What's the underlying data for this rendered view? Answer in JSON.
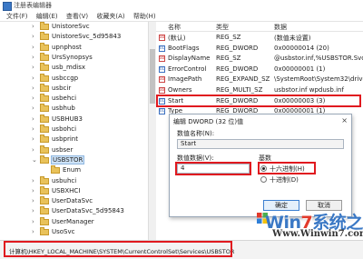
{
  "window": {
    "title": "注册表编辑器"
  },
  "menu": [
    "文件(F)",
    "编辑(E)",
    "查看(V)",
    "收藏夹(A)",
    "帮助(H)"
  ],
  "tree": {
    "items": [
      {
        "label": "UnistoreSvc",
        "level": 0,
        "expander": "›"
      },
      {
        "label": "UnistoreSvc_5d95843",
        "level": 0,
        "expander": "›"
      },
      {
        "label": "upnphost",
        "level": 0,
        "expander": "›"
      },
      {
        "label": "UrsSynopsys",
        "level": 0,
        "expander": "›"
      },
      {
        "label": "usb_mdisx",
        "level": 0,
        "expander": "›"
      },
      {
        "label": "usbccgp",
        "level": 0,
        "expander": "›"
      },
      {
        "label": "usbcir",
        "level": 0,
        "expander": "›"
      },
      {
        "label": "usbehci",
        "level": 0,
        "expander": "›"
      },
      {
        "label": "usbhub",
        "level": 0,
        "expander": "›"
      },
      {
        "label": "USBHUB3",
        "level": 0,
        "expander": "›"
      },
      {
        "label": "usbohci",
        "level": 0,
        "expander": "›"
      },
      {
        "label": "usbprint",
        "level": 0,
        "expander": "›"
      },
      {
        "label": "usbser",
        "level": 0,
        "expander": "›"
      },
      {
        "label": "USBSTOR",
        "level": 0,
        "expander": "⌄",
        "selected": true
      },
      {
        "label": "Enum",
        "level": 1,
        "expander": ""
      },
      {
        "label": "usbuhci",
        "level": 0,
        "expander": "›"
      },
      {
        "label": "USBXHCI",
        "level": 0,
        "expander": "›"
      },
      {
        "label": "UserDataSvc",
        "level": 0,
        "expander": "›"
      },
      {
        "label": "UserDataSvc_5d95843",
        "level": 0,
        "expander": "›"
      },
      {
        "label": "UserManager",
        "level": 0,
        "expander": "›"
      },
      {
        "label": "UsoSvc",
        "level": 0,
        "expander": "›"
      }
    ]
  },
  "values": {
    "headers": {
      "name": "名称",
      "type": "类型",
      "data": "数据"
    },
    "rows": [
      {
        "icon": "sz",
        "name": "(默认)",
        "type": "REG_SZ",
        "data": "(数值未设置)"
      },
      {
        "icon": "dw",
        "name": "BootFlags",
        "type": "REG_DWORD",
        "data": "0x00000014 (20)"
      },
      {
        "icon": "sz",
        "name": "DisplayName",
        "type": "REG_SZ",
        "data": "@usbstor.inf,%USBSTOR.SvcDesc"
      },
      {
        "icon": "dw",
        "name": "ErrorControl",
        "type": "REG_DWORD",
        "data": "0x00000001 (1)"
      },
      {
        "icon": "sz",
        "name": "ImagePath",
        "type": "REG_EXPAND_SZ",
        "data": "\\SystemRoot\\System32\\drivers\\U"
      },
      {
        "icon": "sz",
        "name": "Owners",
        "type": "REG_MULTI_SZ",
        "data": "usbstor.inf wpdusb.inf"
      },
      {
        "icon": "dw",
        "name": "Start",
        "type": "REG_DWORD",
        "data": "0x00000003 (3)",
        "highlighted": true
      },
      {
        "icon": "dw",
        "name": "Type",
        "type": "REG_DWORD",
        "data": "0x00000001 (1)"
      }
    ]
  },
  "dialog": {
    "title": "编辑 DWORD (32 位)值",
    "close": "×",
    "name_label": "数值名称(N):",
    "name_value": "Start",
    "data_label": "数值数据(V):",
    "data_value": "4",
    "base_label": "基数",
    "radio_hex": "十六进制(H)",
    "radio_dec": "十进制(D)",
    "ok": "确定",
    "cancel": "取消"
  },
  "status": {
    "path": "计算机\\HKEY_LOCAL_MACHINE\\SYSTEM\\CurrentControlSet\\Services\\USBSTOR"
  },
  "watermark": {
    "logo_a": "Win",
    "logo_7": "7",
    "logo_b": "系统之家",
    "url": "Www.Winwin7.com"
  },
  "colors": {
    "highlight_red": "#e0191f",
    "selection_blue": "#cde2f7",
    "accent": "#3a78c5"
  }
}
